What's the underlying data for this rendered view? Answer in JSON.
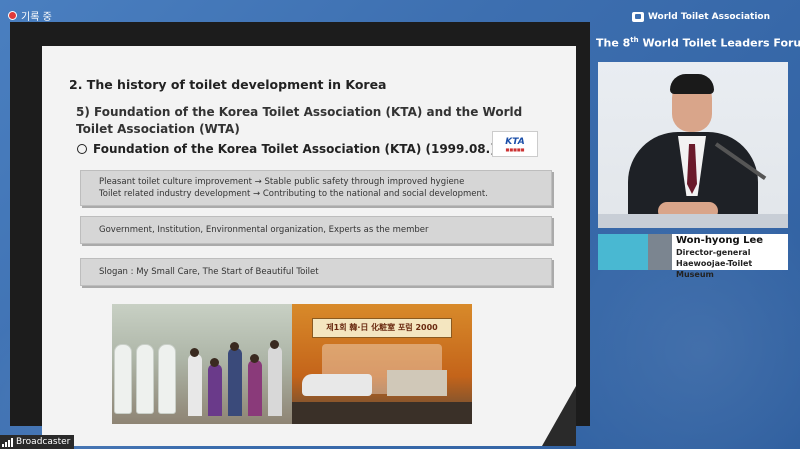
{
  "recording": {
    "label": "기록 중"
  },
  "brand": {
    "name": "World Toilet Association"
  },
  "forum": {
    "prefix": "The 8",
    "sup": "th",
    "suffix": " World Toilet Leaders Forum"
  },
  "slide": {
    "heading": "2. The history of toilet development in Korea",
    "subheading": "5) Foundation of the Korea Toilet Association (KTA) and the World Toilet Association (WTA)",
    "section": "Foundation of the Korea Toilet Association (KTA) (1999.08.)",
    "kta_logo_text": "KTA",
    "boxes": {
      "box1_line1": "Pleasant toilet culture improvement → Stable public safety through improved hygiene",
      "box1_line2": "Toilet related industry development → Contributing to the national and social development.",
      "box2": "Government, Institution, Environmental organization, Experts as the member",
      "box3": "Slogan : My Small Care, The Start of Beautiful Toilet"
    },
    "banner_text": "제1회 韓·日 化粧室 포럼 2000"
  },
  "speaker": {
    "name": "Won-hyong Lee",
    "title_line1": "Director-general",
    "title_line2": "Haewoojae-Toilet Museum"
  },
  "broadcaster": {
    "label": "Broadcaster"
  },
  "colors": {
    "accent_cyan": "#49b8d2",
    "background_blue": "#3d6fb0",
    "rec_red": "#e03a3a"
  }
}
